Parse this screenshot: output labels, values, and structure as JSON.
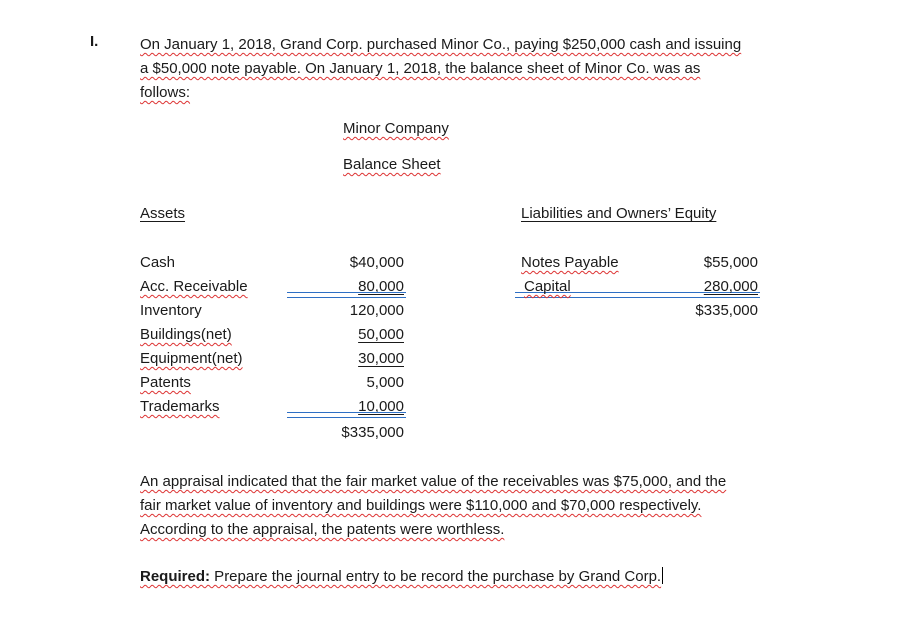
{
  "problem_number": "I.",
  "intro": {
    "line1": "On January 1, 2018, Grand Corp. purchased Minor Co., paying $250,000 cash and issuing",
    "line2": "a $50,000 note payable. On January 1, 2018, the balance sheet of Minor Co. was as",
    "line3": "follows:"
  },
  "balance_sheet": {
    "company": "Minor Company",
    "title": "Balance Sheet",
    "assets_header": "Assets",
    "liabilities_header": "Liabilities and Owners’ Equity",
    "assets": [
      {
        "label": "Cash",
        "value": "$40,000"
      },
      {
        "label": "Acc. Receivable",
        "value": "80,000"
      },
      {
        "label": "Inventory",
        "value": "120,000"
      },
      {
        "label": "Buildings(net)",
        "value": "50,000"
      },
      {
        "label": "Equipment(net)",
        "value": "30,000"
      },
      {
        "label": "Patents",
        "value": "5,000"
      },
      {
        "label": "Trademarks",
        "value": "10,000"
      }
    ],
    "assets_total": "$335,000",
    "liabilities": [
      {
        "label": "Notes Payable",
        "value": "$55,000"
      },
      {
        "label": "Capital",
        "value": "280,000"
      }
    ],
    "liabilities_total": "$335,000"
  },
  "appraisal": {
    "line1": "An appraisal indicated that the fair market value of the receivables was $75,000, and the",
    "line2": "fair market value of inventory and buildings were $110,000 and $70,000 respectively.",
    "line3": "According to the appraisal, the patents were worthless."
  },
  "required": {
    "label": "Required:",
    "text": " Prepare the journal entry to be record the purchase by Grand Corp."
  }
}
